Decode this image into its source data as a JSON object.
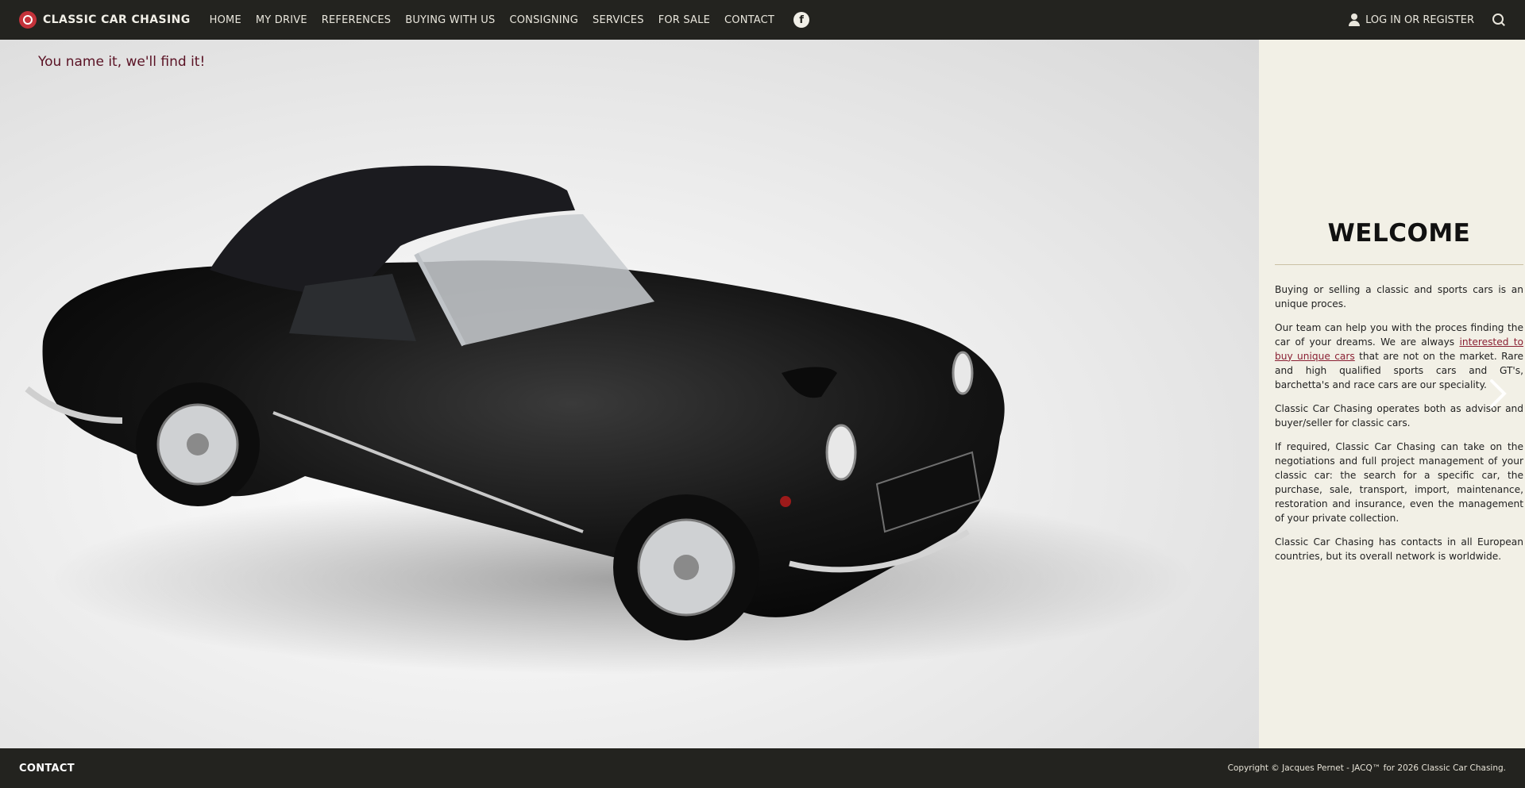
{
  "brand": {
    "name": "CLASSIC CAR CHASING"
  },
  "nav": {
    "items": [
      "HOME",
      "MY DRIVE",
      "REFERENCES",
      "BUYING WITH US",
      "CONSIGNING",
      "SERVICES",
      "FOR SALE",
      "CONTACT"
    ],
    "facebook_glyph": "f",
    "login_label": "LOG IN OR REGISTER"
  },
  "hero": {
    "tagline": "You name it, we'll find it!"
  },
  "panel": {
    "title": "WELCOME",
    "p1": "Buying or selling a classic and sports cars is an unique proces.",
    "p2_before": "Our team can help you with the proces finding the car of your dreams. We are always ",
    "p2_link": "interested to buy unique cars",
    "p2_after": " that are not on the market. Rare and high qualified sports cars and GT's, barchetta's and race cars are our speciality.",
    "p3": "Classic Car Chasing operates both as advisor and buyer/seller for classic cars.",
    "p4": "If required, Classic Car Chasing can take on the negotiations and full project management of your classic car: the search for a specific car, the purchase, sale, transport, import, maintenance, restoration and insurance, even the management of your private collection.",
    "p5": "Classic Car Chasing has contacts in all European countries, but its overall network is worldwide."
  },
  "footer": {
    "contact_label": "CONTACT",
    "copyright": "Copyright © Jacques Pernet - JACQ™ for 2026 Classic Car Chasing."
  },
  "colors": {
    "bar": "#23231f",
    "panel": "#f2f0e6",
    "accent": "#5a1224",
    "link": "#8a2033"
  }
}
